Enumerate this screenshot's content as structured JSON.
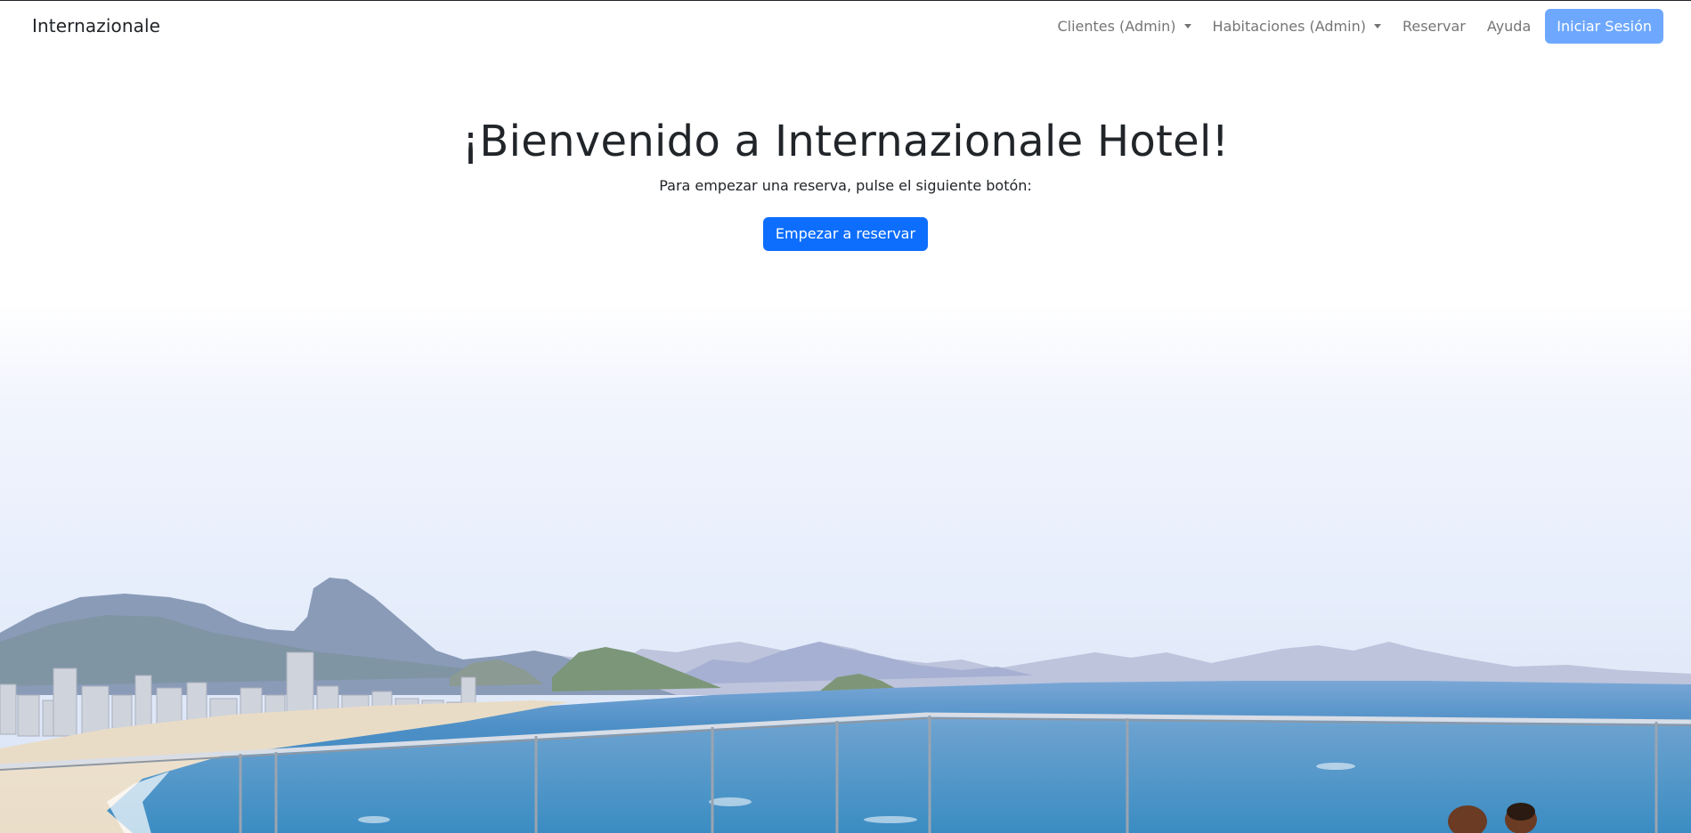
{
  "navbar": {
    "brand": "Internazionale",
    "items": [
      {
        "label": "Clientes (Admin)",
        "dropdown": true
      },
      {
        "label": "Habitaciones (Admin)",
        "dropdown": true
      },
      {
        "label": "Reservar",
        "dropdown": false
      },
      {
        "label": "Ayuda",
        "dropdown": false
      }
    ],
    "login_label": "Iniciar Sesión"
  },
  "hero": {
    "title": "¡Bienvenido a Internazionale Hotel!",
    "subtitle": "Para empezar una reserva, pulse el siguiente botón:",
    "cta_label": "Empezar a reservar"
  },
  "background": {
    "image": "beach-panorama-image"
  },
  "colors": {
    "primary": "#0d6efd",
    "login_button": "#6ea8fe",
    "nav_text": "#737373",
    "heading": "#212529"
  }
}
